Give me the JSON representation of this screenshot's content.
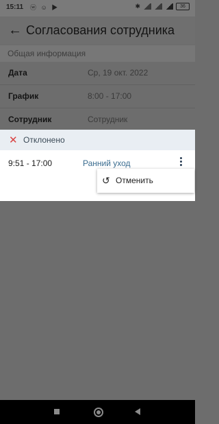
{
  "status_bar": {
    "time": "15:11",
    "left_icons": "ⓦ ☺ ▶",
    "battery": "36"
  },
  "header": {
    "back_icon": "←",
    "title": "Согласования сотрудника"
  },
  "info": {
    "section_title": "Общая информация",
    "rows": [
      {
        "label": "Дата",
        "value": "Ср, 19 окт. 2022"
      },
      {
        "label": "График",
        "value": "8:00 - 17:00"
      },
      {
        "label": "Сотрудник",
        "value": "Сотрудник"
      }
    ]
  },
  "card": {
    "status_icon": "✕",
    "status_label": "Отклонено",
    "entry_time": "9:51 - 17:00",
    "entry_type": "Ранний уход"
  },
  "popup": {
    "undo_icon": "↺",
    "cancel_label": "Отменить"
  },
  "colors": {
    "reject_red": "#d94040",
    "accent_blue": "#3a6c8f"
  }
}
